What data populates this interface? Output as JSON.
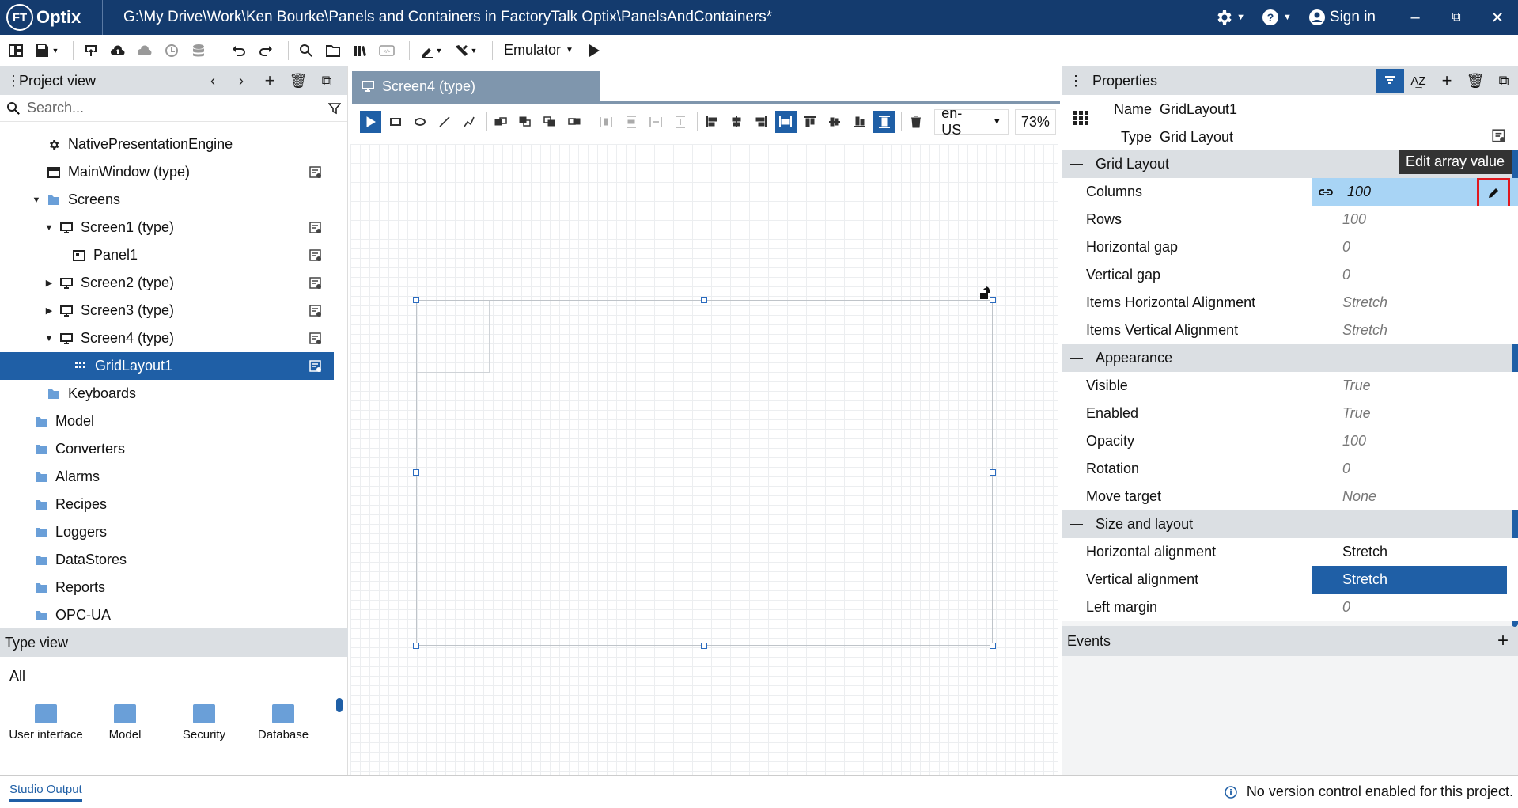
{
  "app": {
    "logo_text": "Optix",
    "title": "G:\\My Drive\\Work\\Ken Bourke\\Panels and Containers in FactoryTalk Optix\\PanelsAndContainers*",
    "sign_in": "Sign in"
  },
  "toolbar": {
    "emulator_label": "Emulator"
  },
  "project_view": {
    "title": "Project view",
    "search_placeholder": "Search...",
    "items": [
      {
        "label": "NativePresentationEngine"
      },
      {
        "label": "MainWindow (type)"
      },
      {
        "label": "Screens"
      },
      {
        "label": "Screen1 (type)"
      },
      {
        "label": "Panel1"
      },
      {
        "label": "Screen2 (type)"
      },
      {
        "label": "Screen3 (type)"
      },
      {
        "label": "Screen4 (type)"
      },
      {
        "label": "GridLayout1"
      },
      {
        "label": "Keyboards"
      },
      {
        "label": "Model"
      },
      {
        "label": "Converters"
      },
      {
        "label": "Alarms"
      },
      {
        "label": "Recipes"
      },
      {
        "label": "Loggers"
      },
      {
        "label": "DataStores"
      },
      {
        "label": "Reports"
      },
      {
        "label": "OPC-UA"
      }
    ]
  },
  "type_view": {
    "title": "Type view",
    "filter": "All",
    "items": [
      {
        "label": "User interface"
      },
      {
        "label": "Model"
      },
      {
        "label": "Security"
      },
      {
        "label": "Database"
      }
    ]
  },
  "editor": {
    "tab_label": "Screen4 (type)",
    "locale": "en-US",
    "zoom": "73%"
  },
  "properties": {
    "title": "Properties",
    "name_label": "Name",
    "name_value": "GridLayout1",
    "type_label": "Type",
    "type_value": "Grid Layout",
    "tooltip": "Edit array value",
    "sections": [
      {
        "title": "Grid Layout",
        "rows": [
          {
            "name": "Columns",
            "value": "100"
          },
          {
            "name": "Rows",
            "value": "100"
          },
          {
            "name": "Horizontal gap",
            "value": "0"
          },
          {
            "name": "Vertical gap",
            "value": "0"
          },
          {
            "name": "Items Horizontal Alignment",
            "value": "Stretch"
          },
          {
            "name": "Items Vertical Alignment",
            "value": "Stretch"
          }
        ]
      },
      {
        "title": "Appearance",
        "rows": [
          {
            "name": "Visible",
            "value": "True"
          },
          {
            "name": "Enabled",
            "value": "True"
          },
          {
            "name": "Opacity",
            "value": "100"
          },
          {
            "name": "Rotation",
            "value": "0"
          },
          {
            "name": "Move target",
            "value": "None"
          }
        ]
      },
      {
        "title": "Size and layout",
        "rows": [
          {
            "name": "Horizontal alignment",
            "value": "Stretch"
          },
          {
            "name": "Vertical alignment",
            "value": "Stretch"
          },
          {
            "name": "Left margin",
            "value": "0"
          }
        ]
      }
    ],
    "events_title": "Events"
  },
  "status": {
    "output_tab": "Studio Output",
    "message": "No version control enabled for this project."
  },
  "colors": {
    "titlebar": "#143b6e",
    "accent": "#1f5fa6",
    "highlight": "#a8d4f5",
    "callout": "#e0181f"
  }
}
